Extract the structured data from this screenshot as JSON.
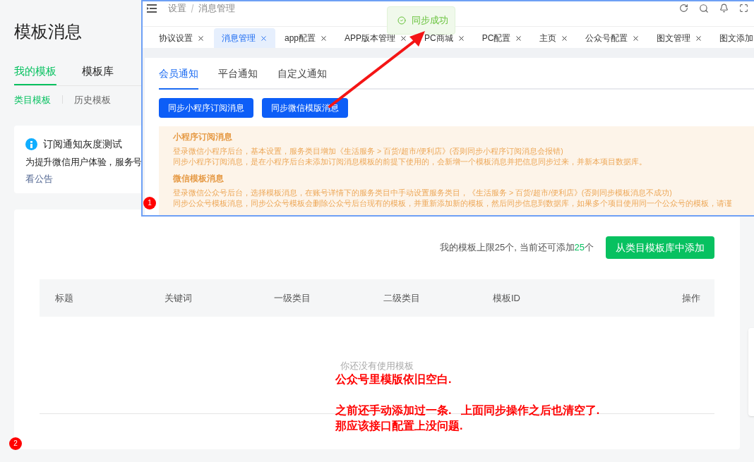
{
  "page": {
    "title": "模板消息",
    "tabs": [
      {
        "label": "我的模板",
        "selected": true
      },
      {
        "label": "模板库",
        "selected": false
      }
    ],
    "subtabs": [
      {
        "label": "类目模板",
        "selected": true
      },
      {
        "label": "历史模板",
        "selected": false
      }
    ],
    "notice": {
      "title": "订阅通知灰度测试",
      "text": "为提升微信用户体验，服务号",
      "link": "看公告"
    },
    "quota": {
      "text": "我的模板上限25个, 当前还可添加",
      "count": "25",
      "unit": "个"
    },
    "add_button": "从类目模板库中添加",
    "table": {
      "columns": [
        "标题",
        "关键词",
        "一级类目",
        "二级类目",
        "模板ID",
        "操作"
      ],
      "empty_text": "你还没有使用模板"
    }
  },
  "overlay": {
    "breadcrumb": [
      "设置",
      "消息管理"
    ],
    "tabs": [
      {
        "label": "协议设置",
        "selected": false,
        "close": true
      },
      {
        "label": "消息管理",
        "selected": true,
        "close": true
      },
      {
        "label": "app配置",
        "selected": false,
        "close": true
      },
      {
        "label": "APP版本管理",
        "selected": false,
        "close": true
      },
      {
        "label": "PC商城",
        "selected": false,
        "close": true
      },
      {
        "label": "PC配置",
        "selected": false,
        "close": true
      },
      {
        "label": "主页",
        "selected": false,
        "close": true
      },
      {
        "label": "公众号配置",
        "selected": false,
        "close": true
      },
      {
        "label": "图文管理",
        "selected": false,
        "close": true
      },
      {
        "label": "图文添加",
        "selected": false,
        "close": false
      }
    ],
    "inner_tabs": [
      {
        "label": "会员通知",
        "selected": true
      },
      {
        "label": "平台通知",
        "selected": false
      },
      {
        "label": "自定义通知",
        "selected": false
      }
    ],
    "buttons": [
      "同步小程序订阅消息",
      "同步微信模版消息"
    ],
    "info": [
      {
        "heading": "小程序订阅消息",
        "lines": [
          "登录微信小程序后台，基本设置，服务类目增加《生活服务 > 百货/超市/便利店》(否则同步小程序订阅消息会报错)",
          "同步小程序订阅消息，是在小程序后台未添加订阅消息模板的前提下使用的，会新增一个模板消息并把信息同步过来，并新本项目数据库。"
        ]
      },
      {
        "heading": "微信模板消息",
        "lines": [
          "登录微信公众号后台，选择模板消息，在账号详情下的服务类目中手动设置服务类目，《生活服务 > 百货/超市/便利店》(否则同步模板消息不成功)",
          "同步公众号模板消息，同步公众号模板会删除公众号后台现有的模板，并重新添加新的模板，然后同步信息到数据库，如果多个项目使用同一个公众号的模板，请谨"
        ]
      }
    ]
  },
  "toast": {
    "text": "同步成功"
  },
  "annotation": {
    "paragraphs": [
      [
        "公众号里模版依旧空白."
      ],
      [
        "之前还手动添加过一条.   上面同步操作之后也清空了.",
        "那应该接口配置上没问题."
      ]
    ]
  },
  "markers": [
    "1",
    "2"
  ]
}
